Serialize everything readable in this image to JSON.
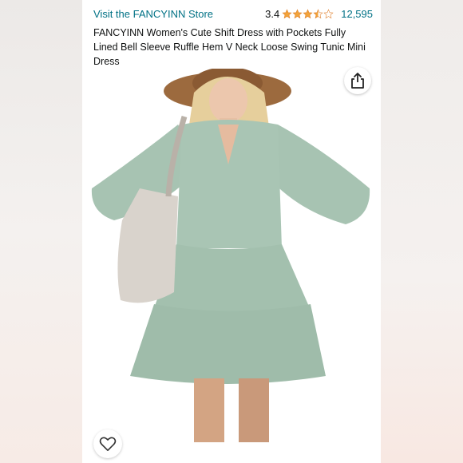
{
  "header": {
    "store_link": "Visit the FANCYINN Store",
    "rating": "3.4",
    "rating_value": 3.4,
    "review_count": "12,595",
    "title": "FANCYINN Women's Cute Shift Dress with Pockets Fully Lined Bell Sleeve Ruffle Hem V Neck Loose Swing Tunic Mini Dress"
  },
  "image": {
    "dress_color": "#a7c3b2",
    "hat_color": "#9c6a3e",
    "bag_color": "#d9d3cc"
  },
  "icons": {
    "share": "share-icon",
    "wishlist": "heart-icon"
  },
  "colors": {
    "link": "#007185",
    "star": "#f2a33a"
  }
}
